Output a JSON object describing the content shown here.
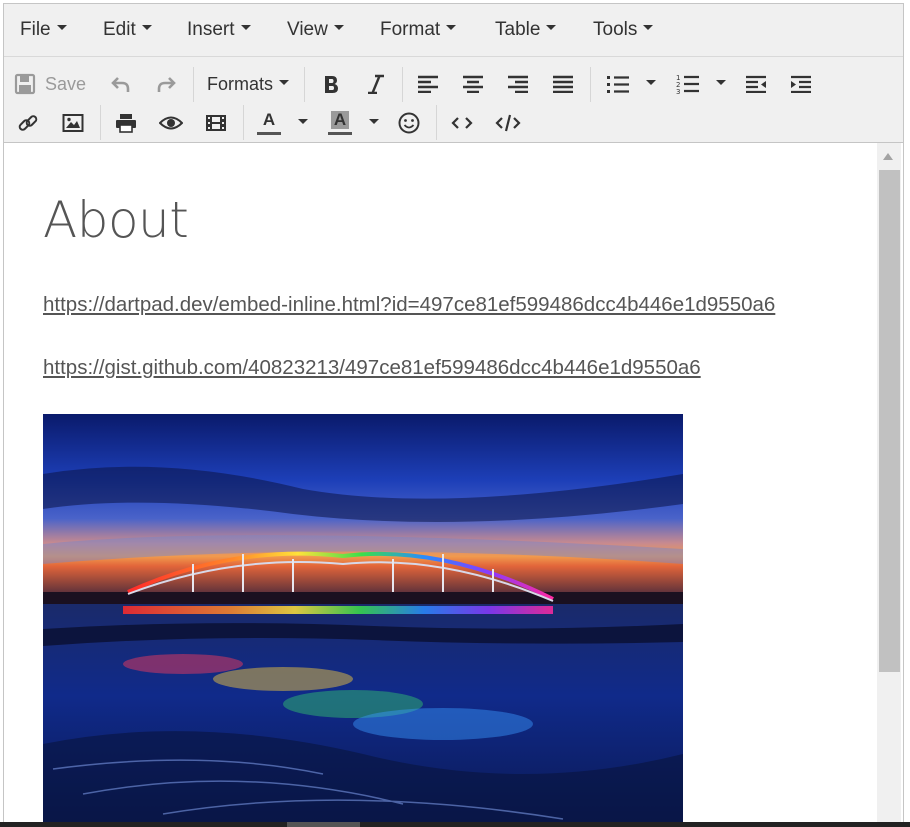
{
  "menubar": {
    "items": [
      "File",
      "Edit",
      "Insert",
      "View",
      "Format",
      "Table",
      "Tools"
    ]
  },
  "toolbar": {
    "save_label": "Save",
    "formats_label": "Formats",
    "font_color_letter": "A",
    "bg_color_letter": "A"
  },
  "content": {
    "heading": "About",
    "links": [
      "https://dartpad.dev/embed-inline.html?id=497ce81ef599486dcc4b446e1d9550a6",
      "https://gist.github.com/40823213/497ce81ef599486dcc4b446e1d9550a6"
    ]
  },
  "colors": {
    "toolbar_bg": "#f0f0f0",
    "text": "#555555",
    "icon": "#333333",
    "disabled": "#9a9a9a"
  }
}
